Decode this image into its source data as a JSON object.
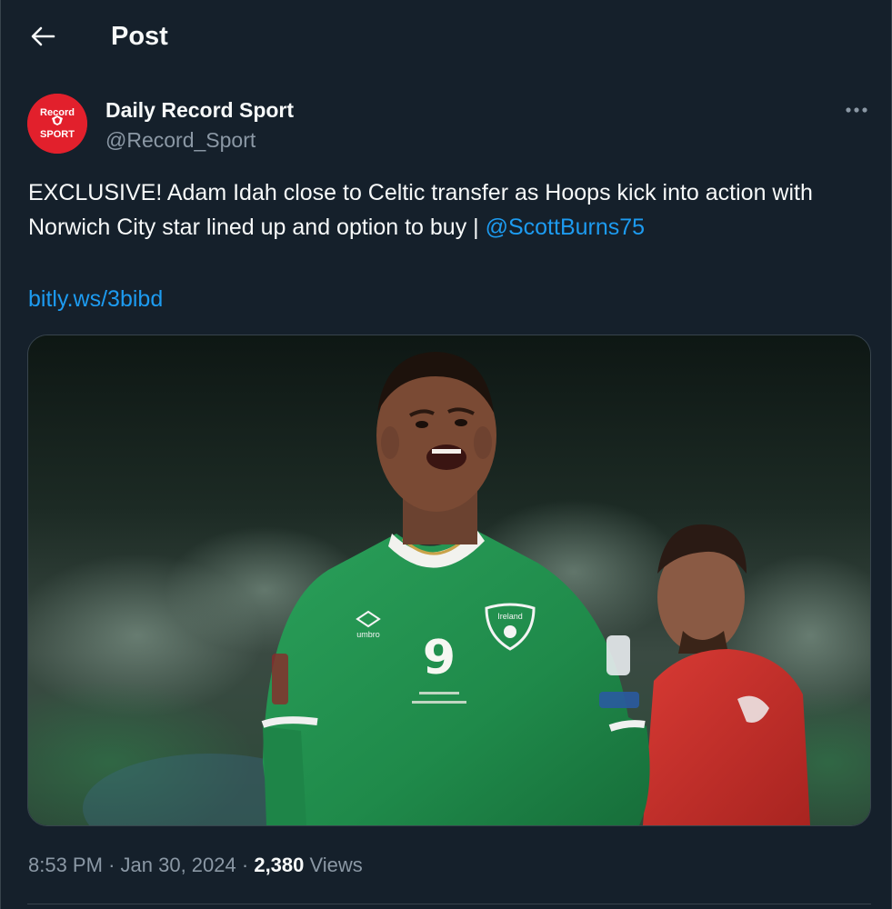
{
  "header": {
    "title": "Post"
  },
  "author": {
    "name": "Daily Record Sport",
    "handle": "@Record_Sport",
    "avatar_text_top": "Record",
    "avatar_text_bottom": "SPORT"
  },
  "tweet": {
    "text": "EXCLUSIVE! Adam Idah close to Celtic transfer as Hoops kick into action with Norwich City star lined up and option to buy | ",
    "mention": "@ScottBurns75",
    "link": "bitly.ws/3bibd"
  },
  "media": {
    "shirt_number": "9",
    "shirt_brand": "umbro",
    "crest_text": "Ireland"
  },
  "meta": {
    "time": "8:53 PM",
    "date": "Jan 30, 2024",
    "separator": "·",
    "views_count": "2,380",
    "views_label": "Views"
  },
  "colors": {
    "background": "#15202b",
    "text": "#f7f9f9",
    "muted": "#8b98a5",
    "accent": "#1d9bf0",
    "avatar": "#e2202c"
  },
  "icons": {
    "back": "arrow-left-icon",
    "more": "more-horizontal-icon"
  }
}
